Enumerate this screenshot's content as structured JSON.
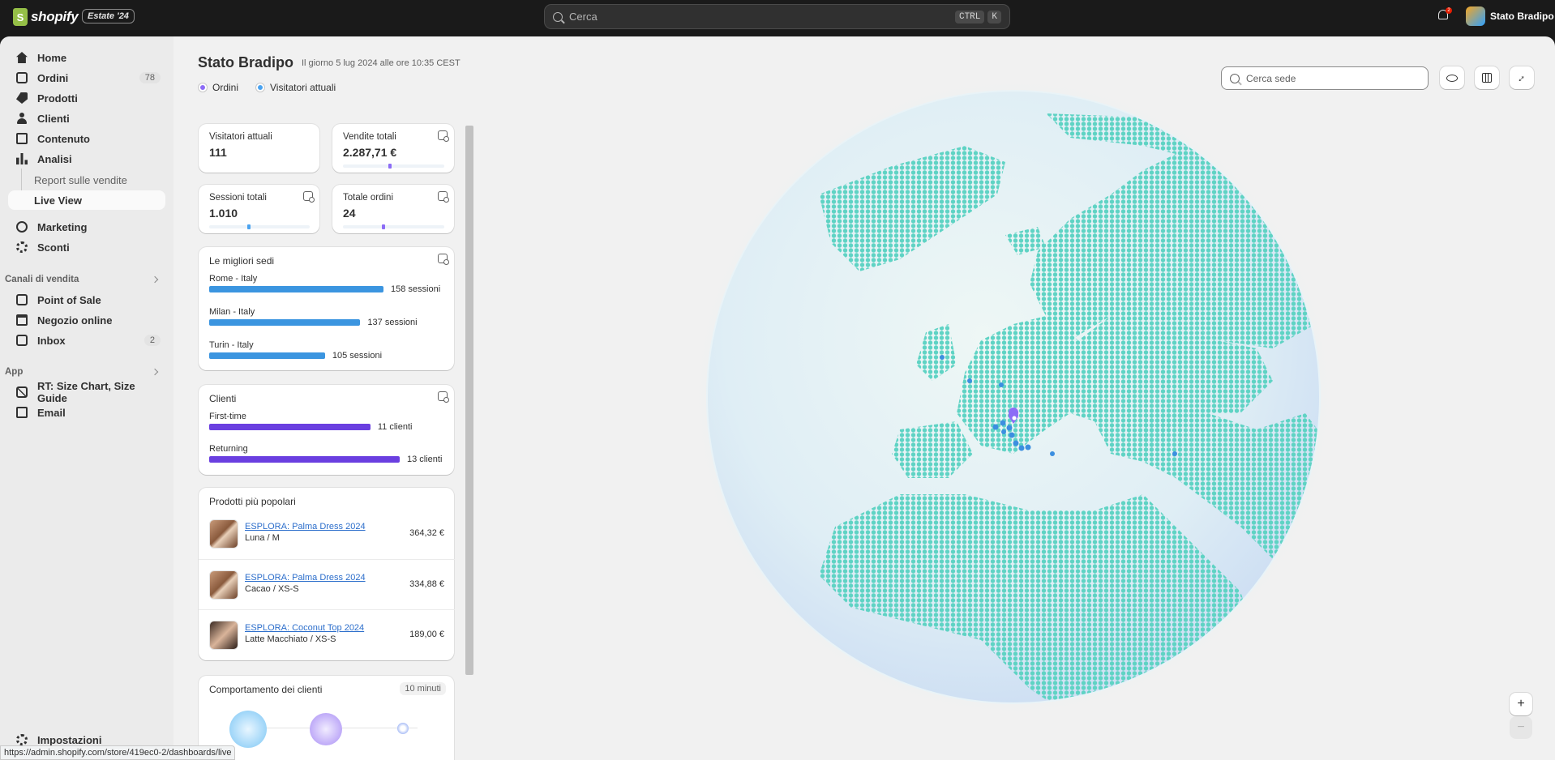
{
  "topbar": {
    "brand": "shopify",
    "edition": "Estate '24",
    "search_placeholder": "Cerca",
    "shortcut_keys": [
      "CTRL",
      "K"
    ],
    "notifications_count": "2",
    "store_name": "Stato Bradipo"
  },
  "sidebar": {
    "items": [
      {
        "label": "Home",
        "icon": "home-icon"
      },
      {
        "label": "Ordini",
        "icon": "orders-icon",
        "count": "78"
      },
      {
        "label": "Prodotti",
        "icon": "tag-icon"
      },
      {
        "label": "Clienti",
        "icon": "person-icon"
      },
      {
        "label": "Contenuto",
        "icon": "content-icon"
      },
      {
        "label": "Analisi",
        "icon": "chart-icon"
      }
    ],
    "analisi_sub": [
      "Report sulle vendite",
      "Live View"
    ],
    "items2": [
      {
        "label": "Marketing",
        "icon": "target-icon"
      },
      {
        "label": "Sconti",
        "icon": "discount-icon"
      }
    ],
    "sales_channels_label": "Canali di vendita",
    "channels": [
      {
        "label": "Point of Sale",
        "icon": "pos-icon"
      },
      {
        "label": "Negozio online",
        "icon": "store-icon"
      },
      {
        "label": "Inbox",
        "icon": "inbox-icon",
        "count": "2"
      }
    ],
    "apps_label": "App",
    "apps": [
      {
        "label": "RT: Size Chart, Size Guide",
        "icon": "app-icon"
      },
      {
        "label": "Email",
        "icon": "mail-icon"
      }
    ],
    "settings_label": "Impostazioni"
  },
  "page": {
    "title": "Stato Bradipo",
    "subtitle": "Il giorno 5 lug 2024 alle ore 10:35 CEST",
    "legend": [
      {
        "label": "Ordini",
        "color": "#8c6cf6"
      },
      {
        "label": "Visitatori attuali",
        "color": "#4aa3f0"
      }
    ]
  },
  "metrics": [
    {
      "label": "Visitatori attuali",
      "value": "111"
    },
    {
      "label": "Vendite totali",
      "value": "2.287,71 €",
      "trend_marker": 0.45,
      "marker_color": "#8c6cf6"
    },
    {
      "label": "Sessioni totali",
      "value": "1.010",
      "trend_marker": 0.38,
      "marker_color": "#4aa3f0"
    },
    {
      "label": "Totale ordini",
      "value": "24",
      "trend_marker": 0.38,
      "marker_color": "#8c6cf6"
    }
  ],
  "top_locations": {
    "title": "Le migliori sedi",
    "items": [
      {
        "name": "Rome - Italy",
        "value": "158 sessioni",
        "sessions": 158
      },
      {
        "name": "Milan - Italy",
        "value": "137 sessioni",
        "sessions": 137
      },
      {
        "name": "Turin - Italy",
        "value": "105 sessioni",
        "sessions": 105
      }
    ],
    "bar_color": "#3b95e0"
  },
  "customers": {
    "title": "Clienti",
    "items": [
      {
        "name": "First-time",
        "value": "11 clienti",
        "count": 11
      },
      {
        "name": "Returning",
        "value": "13 clienti",
        "count": 13
      }
    ],
    "bar_color": "#6a3fe0"
  },
  "top_products": {
    "title": "Prodotti più popolari",
    "items": [
      {
        "name": "ESPLORA: Palma Dress 2024",
        "variant": "Luna / M",
        "price": "364,32 €"
      },
      {
        "name": "ESPLORA: Palma Dress 2024",
        "variant": "Cacao / XS-S",
        "price": "334,88 €"
      },
      {
        "name": "ESPLORA: Coconut Top 2024",
        "variant": "Latte Macchiato / XS-S",
        "price": "189,00 €"
      }
    ]
  },
  "behavior": {
    "title": "Comportamento dei clienti",
    "range": "10 minuti"
  },
  "globe": {
    "search_placeholder": "Cerca sede",
    "land_color": "#5fd3c4"
  },
  "status_url": "https://admin.shopify.com/store/419ec0-2/dashboards/live"
}
